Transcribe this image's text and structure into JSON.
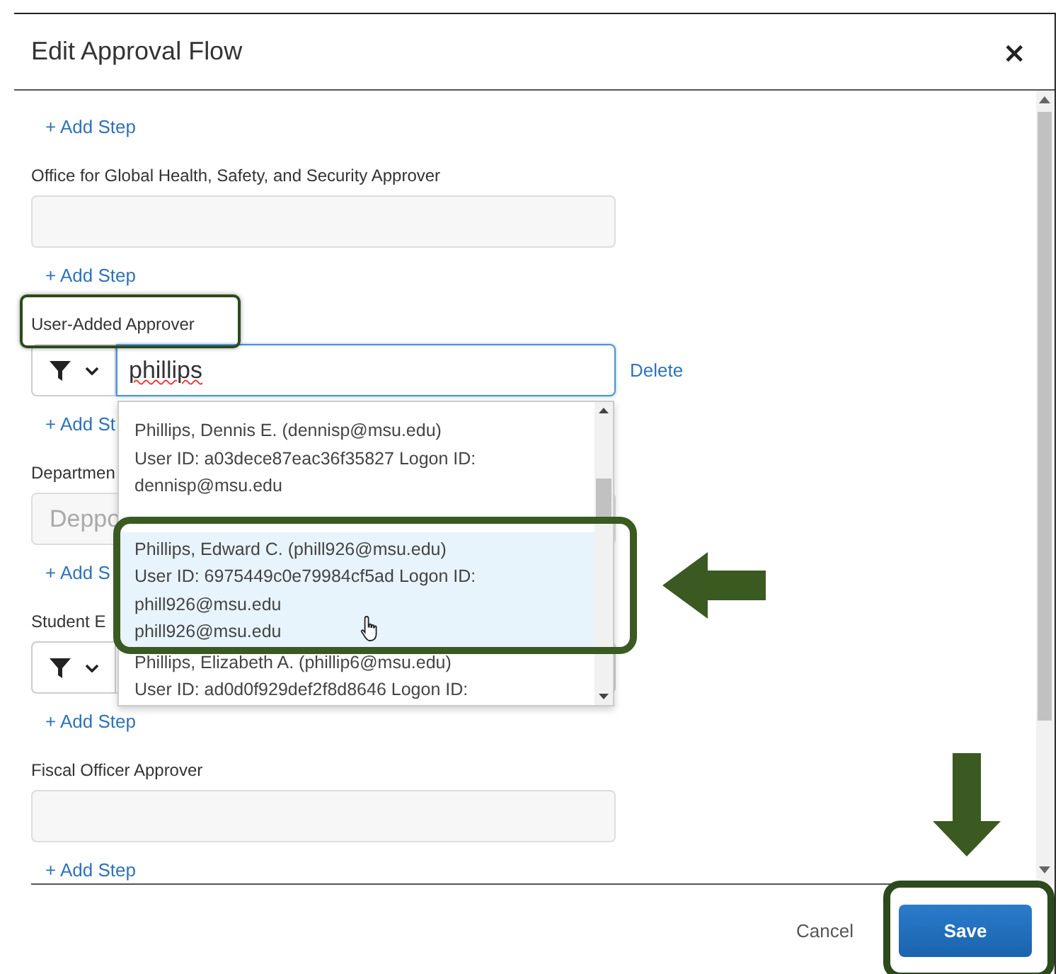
{
  "dialog": {
    "title": "Edit Approval Flow",
    "close": "×"
  },
  "sections": [
    {
      "kind": "add_step",
      "text": "+ Add Step"
    },
    {
      "kind": "field",
      "label": "Office for Global Health, Safety, and Security Approver",
      "highlighted": false
    },
    {
      "kind": "add_step",
      "text": "+ Add Step"
    },
    {
      "kind": "search",
      "label": "User-Added Approver",
      "highlighted": true,
      "value": "phillips",
      "spelling_error": true,
      "focused": true,
      "delete": "Delete"
    },
    {
      "kind": "add_step",
      "text": "+ Add St"
    },
    {
      "kind": "field",
      "label": "Departmen",
      "placeholder": "Deppo",
      "highlighted": false
    },
    {
      "kind": "add_step",
      "text": "+ Add S"
    },
    {
      "kind": "search",
      "label": "Student E",
      "highlighted": false,
      "focused": false
    },
    {
      "kind": "add_step",
      "text": "+ Add Step"
    },
    {
      "kind": "field",
      "label": "Fiscal Officer Approver",
      "highlighted": false
    },
    {
      "kind": "add_step",
      "text": "+ Add Step"
    }
  ],
  "suggestions": {
    "items": [
      {
        "lines": [
          "Phillips, Dennis E. (dennisp@msu.edu)",
          "User ID: a03dece87eac36f35827 Logon ID:",
          "dennisp@msu.edu"
        ],
        "selected": false,
        "highlighted": false,
        "hovered": false
      },
      {
        "lines": [
          "Phillips, Edward C. (phill926@msu.edu)",
          "User ID: 6975449c0e79984cf5ad Logon ID:",
          "phill926@msu.edu",
          "phill926@msu.edu"
        ],
        "selected": true,
        "highlighted": true,
        "hovered": true,
        "arrow": true
      },
      {
        "lines": [
          "Phillips, Elizabeth A. (phillip6@msu.edu)",
          "User ID: ad0d0f929def2f8d8646 Logon ID:"
        ],
        "selected": false,
        "highlighted": false,
        "hovered": false
      }
    ]
  },
  "footer": {
    "cancel": "Cancel",
    "save": {
      "label": "Save",
      "highlighted": true,
      "arrow": true
    }
  }
}
